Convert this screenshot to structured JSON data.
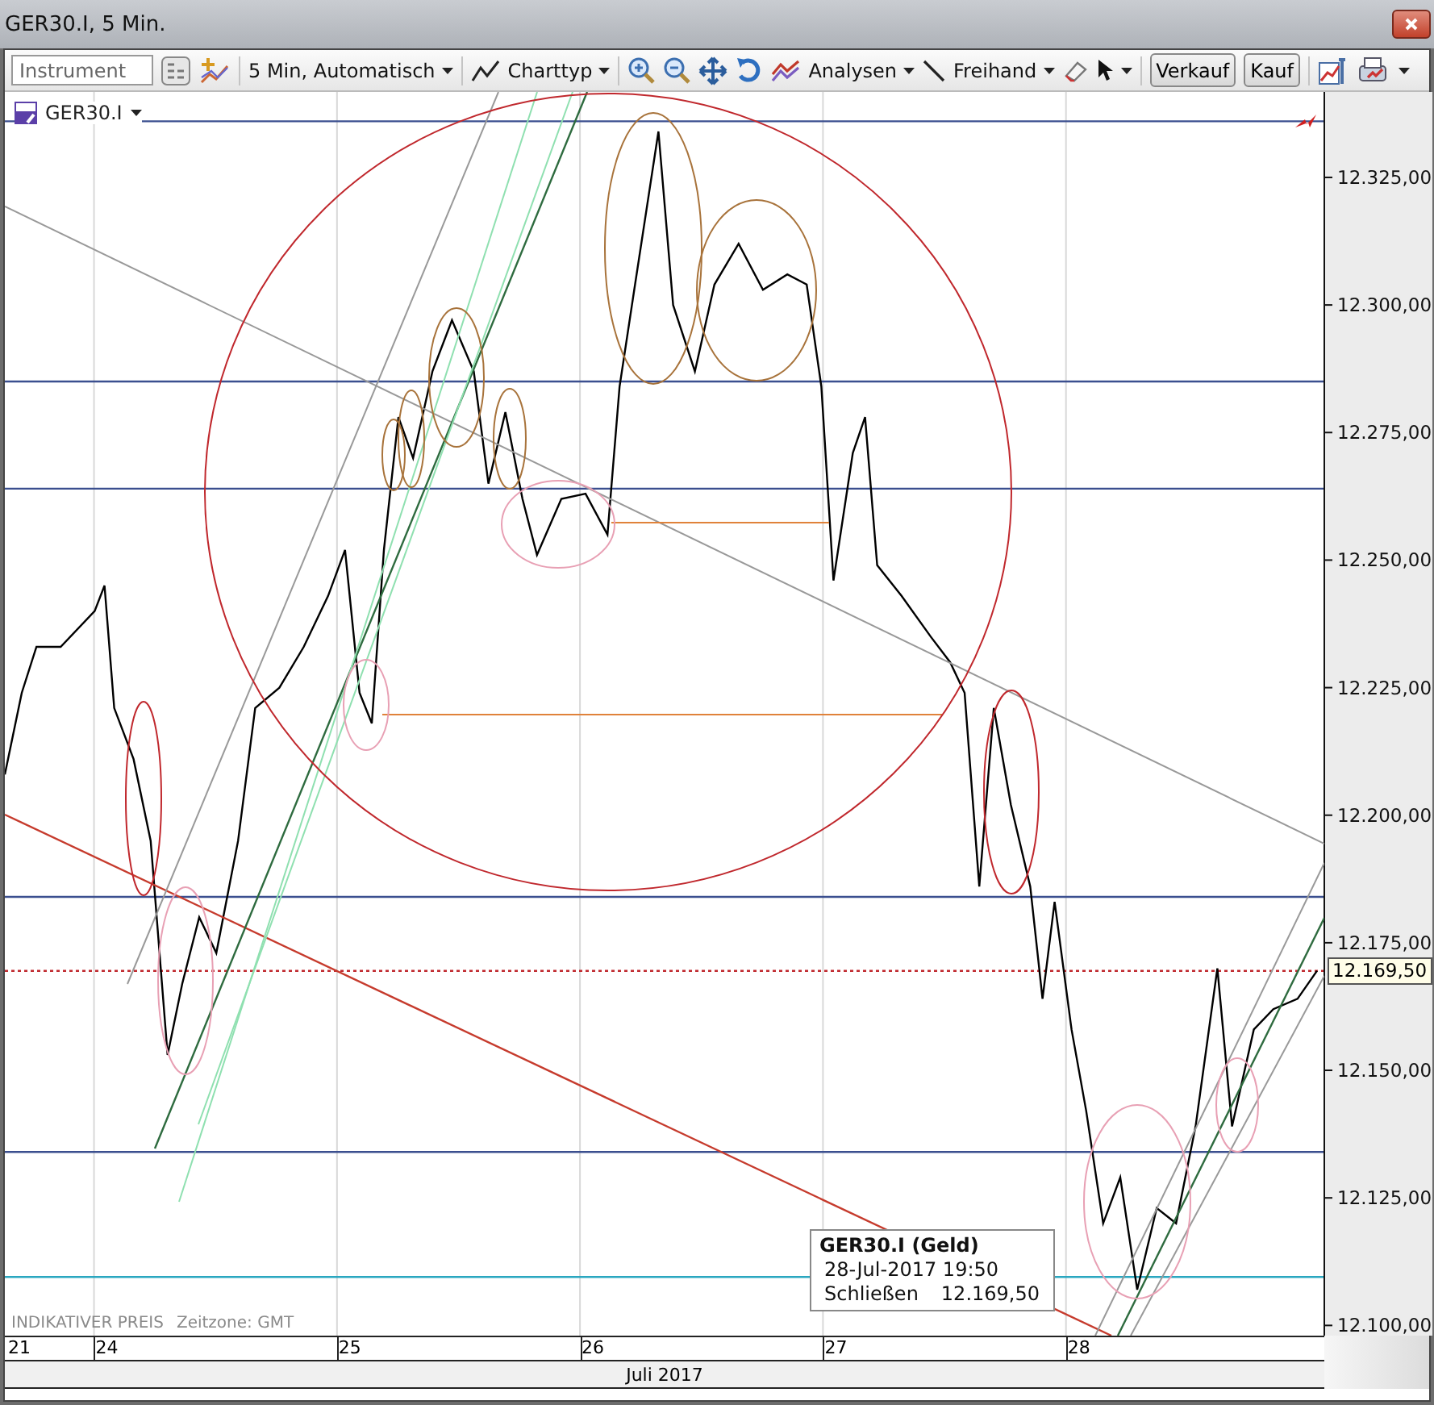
{
  "window": {
    "title": "GER30.I, 5 Min."
  },
  "toolbar": {
    "instrument_field": {
      "placeholder": "Instrument"
    },
    "interval": "5 Min, Automatisch",
    "chart_type": "Charttyp",
    "analyses": "Analysen",
    "drawing": "Freihand",
    "buttons": [
      "Verkauf",
      "Kauf"
    ]
  },
  "chart": {
    "footer_note": "INDIKATIVER PREIS",
    "timezone": "Zeitzone: GMT",
    "last_price": "12.169,50",
    "tooltip": {
      "title": "GER30.I (Geld)",
      "datetime": "28-Jul-2017 19:50",
      "label": "Schließen",
      "value": "12.169,50"
    },
    "first_day_label": "21",
    "month_label": "Juli 2017",
    "chart_data": {
      "type": "line",
      "grid": true,
      "xlim": [
        23.58,
        29.01
      ],
      "ylim": [
        12098,
        12341.75
      ],
      "xticks": [
        {
          "value": 24,
          "label": "24"
        },
        {
          "value": 25,
          "label": "25"
        },
        {
          "value": 26,
          "label": "26"
        },
        {
          "value": 27,
          "label": "27"
        },
        {
          "value": 28,
          "label": "28"
        }
      ],
      "yticks": [
        {
          "value": 12100,
          "label": "12.100,00"
        },
        {
          "value": 12125,
          "label": "12.125,00"
        },
        {
          "value": 12150,
          "label": "12.150,00"
        },
        {
          "value": 12175,
          "label": "12.175,00"
        },
        {
          "value": 12200,
          "label": "12.200,00"
        },
        {
          "value": 12225,
          "label": "12.225,00"
        },
        {
          "value": 12250,
          "label": "12.250,00"
        },
        {
          "value": 12275,
          "label": "12.275,00"
        },
        {
          "value": 12300,
          "label": "12.300,00"
        },
        {
          "value": 12325,
          "label": "12.325,00"
        }
      ],
      "x": [
        23.58,
        23.65,
        23.71,
        23.81,
        23.95,
        23.99,
        24.03,
        24.11,
        24.18,
        24.25,
        24.31,
        24.38,
        24.45,
        24.54,
        24.61,
        24.71,
        24.81,
        24.91,
        24.98,
        25.04,
        25.09,
        25.14,
        25.2,
        25.26,
        25.34,
        25.42,
        25.51,
        25.57,
        25.64,
        25.71,
        25.77,
        25.87,
        25.97,
        26.06,
        26.11,
        26.17,
        26.27,
        26.33,
        26.42,
        26.5,
        26.6,
        26.7,
        26.8,
        26.88,
        26.94,
        26.99,
        27.07,
        27.12,
        27.17,
        27.27,
        27.39,
        27.47,
        27.53,
        27.59,
        27.65,
        27.72,
        27.8,
        27.85,
        27.9,
        27.97,
        28.03,
        28.1,
        28.17,
        28.24,
        28.32,
        28.4,
        28.48,
        28.57,
        28.63,
        28.72,
        28.8,
        28.9,
        28.98
      ],
      "series": [
        {
          "name": "GER30.I",
          "color": "#000000",
          "values": [
            12208,
            12224,
            12233,
            12233,
            12240,
            12245,
            12221,
            12211,
            12195,
            12153,
            12167,
            12180,
            12173,
            12195,
            12221,
            12225,
            12233,
            12243,
            12252,
            12224,
            12218,
            12252,
            12278,
            12270,
            12287,
            12297,
            12287,
            12265,
            12279,
            12262,
            12251,
            12262,
            12263,
            12255,
            12284,
            12303,
            12334,
            12300,
            12287,
            12304,
            12312,
            12303,
            12306,
            12304,
            12284,
            12246,
            12271,
            12278,
            12249,
            12243,
            12235,
            12230,
            12224,
            12186,
            12221,
            12202,
            12186,
            12164,
            12183,
            12158,
            12142,
            12120,
            12129,
            12107,
            12123,
            12120,
            12139,
            12170,
            12139,
            12158,
            12162,
            12164,
            12169.5
          ]
        }
      ],
      "ref_lines": [
        {
          "axis": "y",
          "value": 12336,
          "color": "#3b4f8f"
        },
        {
          "axis": "y",
          "value": 12285,
          "color": "#3b4f8f"
        },
        {
          "axis": "y",
          "value": 12264,
          "color": "#3b4f8f"
        },
        {
          "axis": "y",
          "value": 12184,
          "color": "#3b4f8f"
        },
        {
          "axis": "y",
          "value": 12169.5,
          "color": "#c0282d"
        },
        {
          "axis": "y",
          "value": 12134,
          "color": "#3b4f8f"
        },
        {
          "axis": "y",
          "value": 12109.5,
          "color": "#2aa7c0"
        }
      ]
    }
  }
}
